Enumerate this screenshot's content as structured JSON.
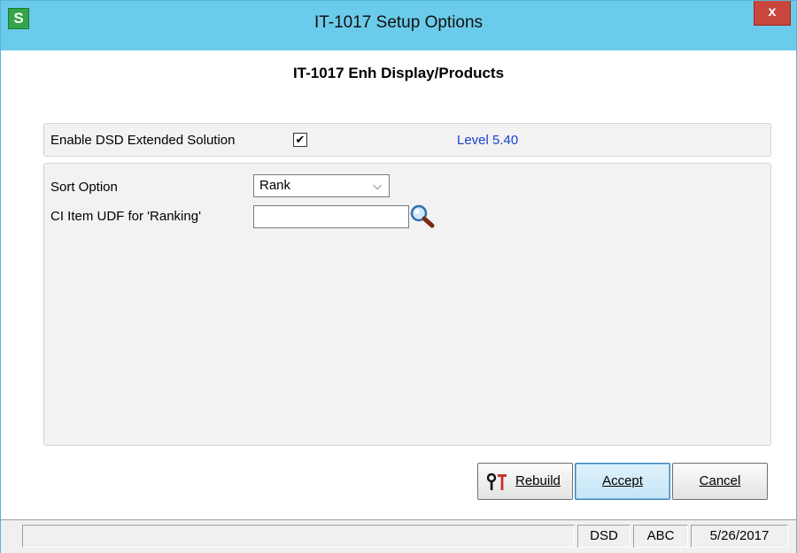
{
  "window": {
    "title": "IT-1017 Setup Options",
    "logo_letter": "S",
    "close_label": "x"
  },
  "heading": "IT-1017 Enh Display/Products",
  "enable_section": {
    "label": "Enable DSD Extended Solution",
    "checked": true,
    "check_glyph": "✔",
    "level": "Level  5.40"
  },
  "options": {
    "sort_label": "Sort Option",
    "sort_value": "Rank",
    "udf_label": "CI Item UDF for 'Ranking'",
    "udf_value": ""
  },
  "buttons": {
    "rebuild": "Rebuild",
    "accept": "Accept",
    "cancel": "Cancel"
  },
  "statusbar": {
    "message": "",
    "company": "DSD",
    "code": "ABC",
    "date": "5/26/2017"
  },
  "colors": {
    "titlebar": "#6bcbea",
    "logo": "#34a34a",
    "close": "#c8463b",
    "level_text": "#1a3fd6"
  }
}
